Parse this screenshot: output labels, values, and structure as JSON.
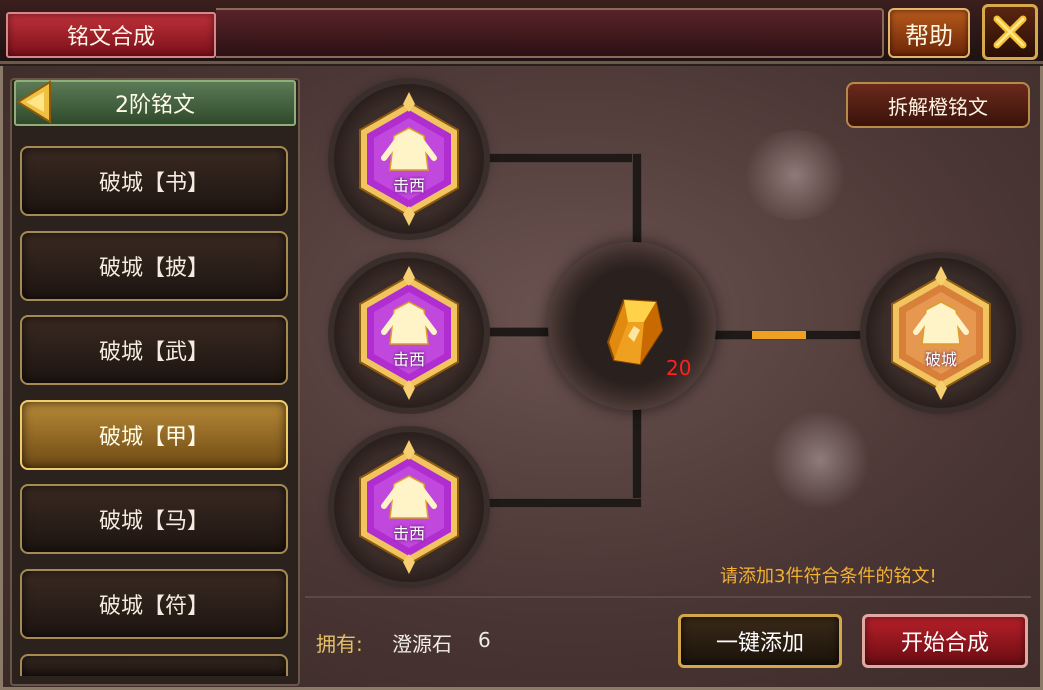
{
  "title": "铭文合成",
  "help_label": "帮助",
  "sidebar": {
    "tier": "2阶铭文",
    "items": [
      {
        "label": "破城【书】",
        "active": false
      },
      {
        "label": "破城【披】",
        "active": false
      },
      {
        "label": "破城【武】",
        "active": false
      },
      {
        "label": "破城【甲】",
        "active": true
      },
      {
        "label": "破城【马】",
        "active": false
      },
      {
        "label": "破城【符】",
        "active": false
      }
    ]
  },
  "decompose_label": "拆解橙铭文",
  "inputs": [
    {
      "label": "击西"
    },
    {
      "label": "击西"
    },
    {
      "label": "击西"
    }
  ],
  "stone_count": "20",
  "output": {
    "label": "破城"
  },
  "hint": "请添加3件符合条件的铭文!",
  "owned": {
    "label": "拥有:",
    "item": "澄源石",
    "count": "6"
  },
  "buttons": {
    "auto_add": "一键添加",
    "start": "开始合成"
  },
  "colors": {
    "purple_rune": "#b02ed0",
    "orange_rune": "#d8803a",
    "active_item": "#b88a38",
    "hint_text": "#f3b032",
    "stone_count": "#ff2020"
  }
}
